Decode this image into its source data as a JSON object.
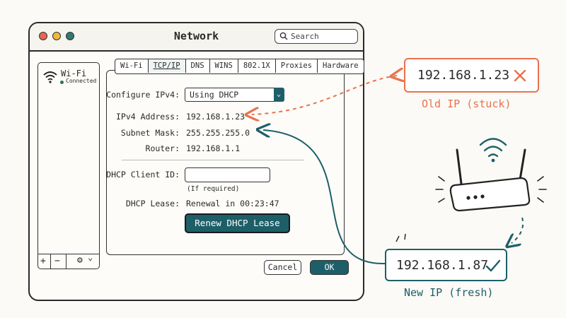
{
  "window": {
    "title": "Network",
    "search_placeholder": "Search",
    "traffic_light_colors": [
      "#e8664f",
      "#f0b73b",
      "#2f7a72"
    ]
  },
  "sidebar": {
    "items": [
      {
        "label": "Wi-Fi",
        "status": "Connected",
        "icon": "wifi-icon",
        "status_color": "#2f6f67"
      }
    ],
    "footer": {
      "add": "+",
      "remove": "−",
      "gear": "⚙",
      "chevron": "⌄"
    }
  },
  "tabs": [
    "Wi-Fi",
    "TCP/IP",
    "DNS",
    "WINS",
    "802.1X",
    "Proxies",
    "Hardware"
  ],
  "active_tab": "TCP/IP",
  "form": {
    "configure_label": "Configure IPv4:",
    "configure_value": "Using DHCP",
    "ipv4_label": "IPv4 Address:",
    "ipv4_value": "192.168.1.23",
    "subnet_label": "Subnet Mask:",
    "subnet_value": "255.255.255.0",
    "router_label": "Router:",
    "router_value": "192.168.1.1",
    "client_id_label": "DHCP Client ID:",
    "client_id_value": "",
    "client_id_hint": "(If required)",
    "lease_label": "DHCP Lease:",
    "lease_value": "Renewal in 00:23:47",
    "renew_button": "Renew DHCP Lease"
  },
  "buttons": {
    "cancel": "Cancel",
    "ok": "OK"
  },
  "annotations": {
    "old_ip": "192.168.1.23",
    "old_caption": "Old IP (stuck)",
    "new_ip": "192.168.1.87",
    "new_caption": "New IP (fresh)"
  },
  "colors": {
    "accent": "#1d5f68",
    "old": "#e8724f",
    "new": "#1d5f68"
  }
}
